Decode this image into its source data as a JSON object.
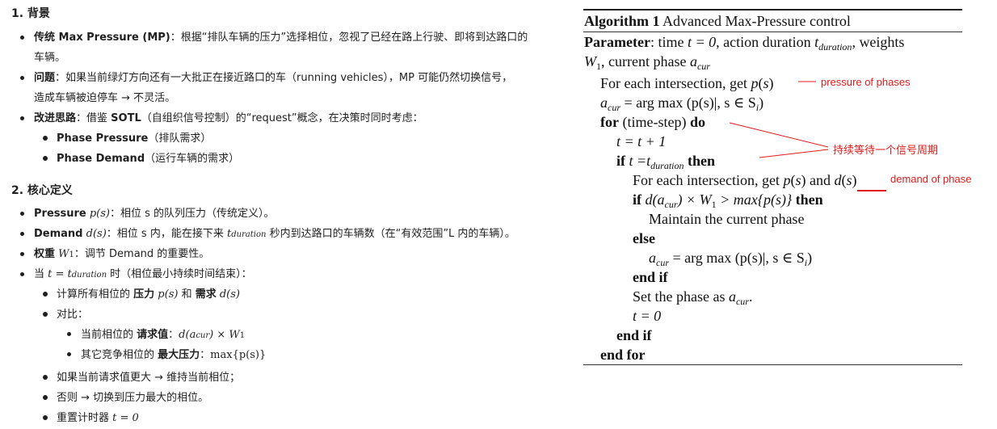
{
  "left": {
    "section1": {
      "title": "1. 背景",
      "items": [
        {
          "bold": "传统 Max Pressure (MP)",
          "text": "：根据“排队车辆的压力”选择相位，忽视了已经在路上行驶、即将到达路口的",
          "cont": "车辆。"
        },
        {
          "bold": "问题",
          "text": "：如果当前绿灯方向还有一大批正在接近路口的车（running vehicles），MP 可能仍然切换信号，",
          "cont": "造成车辆被迫停车 → 不灵活。"
        },
        {
          "bold": "改进思路",
          "text": "：借鉴 ",
          "bold2": "SOTL",
          "text2": "（自组织信号控制）的“request”概念，在决策时同时考虑：",
          "sub": [
            {
              "bold": "Phase Pressure",
              "text": "（排队需求）"
            },
            {
              "bold": "Phase Demand",
              "text": "（运行车辆的需求）"
            }
          ]
        }
      ]
    },
    "section2": {
      "title": "2. 核心定义",
      "pressure": {
        "bold": "Pressure",
        "math": "p(s)",
        "text": "：相位 s 的队列压力（传统定义）。"
      },
      "demand": {
        "bold": "Demand",
        "math": "d(s)",
        "text1": "：相位 s 内，能在接下来 ",
        "math2": "t",
        "math2sub": "duration",
        "text2": " 秒内到达路口的车辆数（在“有效范围”L 内的车辆）。"
      },
      "weight": {
        "bold": "权重",
        "math": "W",
        "mathsub": "1",
        "text": "：调节 Demand 的重要性。"
      },
      "when": {
        "text1": "当 ",
        "math": "t = t",
        "mathsub": "duration",
        "text2": " 时（相位最小持续时间结束）：",
        "compute": {
          "text1": "计算所有相位的 ",
          "bold1": "压力",
          "math1": "p(s)",
          "text2": " 和 ",
          "bold2": "需求",
          "math2": "d(s)"
        },
        "compare": "对比：",
        "request": {
          "text": "当前相位的 ",
          "bold": "请求值",
          "colon": "：",
          "math": "d(a",
          "mathsub": "cur",
          "math2": ") × W",
          "math2sub": "1"
        },
        "maxp": {
          "text": "其它竞争相位的 ",
          "bold": "最大压力",
          "colon": "：",
          "math": "max{p(s)}"
        },
        "keep": "如果当前请求值更大 → 维持当前相位；",
        "switch": "否则 → 切换到压力最大的相位。",
        "reset": {
          "text": "重置计时器 ",
          "math": "t = 0"
        }
      }
    }
  },
  "algorithm": {
    "title_bold": "Algorithm 1",
    "title": " Advanced Max-Pressure control",
    "param_label": "Parameter",
    "param_text1": ": time ",
    "param_math1": "t = 0",
    "param_text2": ", action duration ",
    "param_text3": ", weights",
    "param_line2_text": ", current phase ",
    "lines": {
      "l1": "For each intersection, get ",
      "l2_rest": " = arg max (p(s)|, s ∈ S",
      "l3_for": "for",
      "l3_mid": " (time-step) ",
      "l3_do": "do",
      "l4": "t = t + 1",
      "l5_if": "if",
      "l5_mid": " t =t",
      "l5_then": "then",
      "l6_a": "For each intersection, get ",
      "l6_b": " and ",
      "l7_if": "if",
      "l7_mid": " d(a",
      "l7_mid2": ") × W",
      "l7_mid3": " > max{p(s)} ",
      "l7_then": "then",
      "l8": "Maintain the current phase",
      "l9": "else",
      "l10_rest": " = arg max (p(s)|, s ∈ S",
      "l11": "end if",
      "l12": "Set the phase as ",
      "l13": "t = 0",
      "l14": "end if",
      "l15": "end for"
    },
    "annotations": {
      "pressure": "pressure of phases",
      "wait": "持续等待一个信号周期",
      "demand": "demand of phase"
    }
  },
  "colors": {
    "annotation": "#e01b1b",
    "text": "#1f1f1f"
  }
}
